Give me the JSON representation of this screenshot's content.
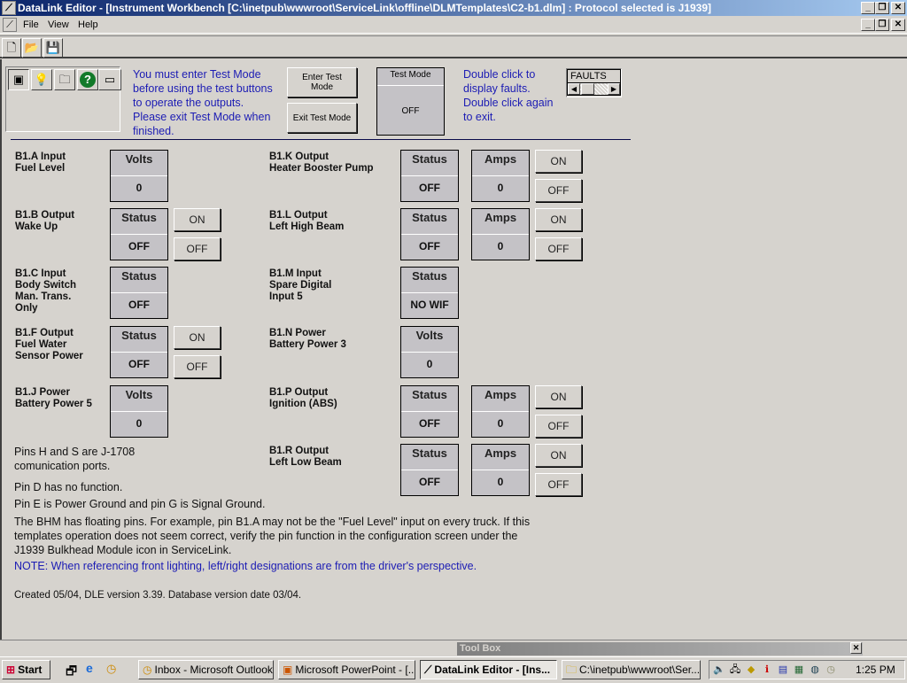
{
  "window": {
    "title": "DataLink Editor - [Instrument Workbench [C:\\inetpub\\wwwroot\\ServiceLink\\offline\\DLMTemplates\\C2-b1.dlm] : Protocol selected is J1939]",
    "minimize": "_",
    "restore": "❐",
    "close": "✕"
  },
  "menu": {
    "items": [
      {
        "label": "File"
      },
      {
        "label": "View"
      },
      {
        "label": "Help"
      }
    ]
  },
  "toolbar": {
    "new": "🗋",
    "open": "📂",
    "save": "💾"
  },
  "icon_panel": {
    "module": "▣",
    "bulb": "💡",
    "folder": "🗀",
    "help": "?",
    "device": "▭"
  },
  "instructions": {
    "test_mode_text": [
      "You must enter Test Mode",
      "before using the test buttons",
      "to operate the outputs.",
      "Please exit Test Mode when",
      "finished."
    ],
    "enter_test_mode": "Enter Test Mode",
    "exit_test_mode": "Exit Test Mode",
    "test_mode_label": "Test Mode",
    "test_mode_value": "OFF",
    "faults_text": [
      "Double click to",
      "display faults.",
      "Double click again",
      "to exit."
    ],
    "faults_label": "FAULTS"
  },
  "signals_left": [
    {
      "label": [
        "B1.A Input",
        "Fuel Level"
      ],
      "gauges": [
        {
          "head": "Volts",
          "value": "0"
        }
      ],
      "buttons": []
    },
    {
      "label": [
        "B1.B Output",
        "Wake Up"
      ],
      "gauges": [
        {
          "head": "Status",
          "value": "OFF"
        }
      ],
      "buttons": [
        "ON",
        "OFF"
      ]
    },
    {
      "label": [
        "B1.C Input",
        "Body Switch",
        "Man. Trans.",
        "Only"
      ],
      "gauges": [
        {
          "head": "Status",
          "value": "OFF"
        }
      ],
      "buttons": []
    },
    {
      "label": [
        "B1.F Output",
        "Fuel Water",
        "Sensor Power"
      ],
      "gauges": [
        {
          "head": "Status",
          "value": "OFF"
        }
      ],
      "buttons": [
        "ON",
        "OFF"
      ]
    },
    {
      "label": [
        "B1.J Power",
        "Battery Power 5"
      ],
      "gauges": [
        {
          "head": "Volts",
          "value": "0"
        }
      ],
      "buttons": []
    }
  ],
  "signals_right": [
    {
      "label": [
        "B1.K Output",
        "Heater Booster Pump"
      ],
      "gauges": [
        {
          "head": "Status",
          "value": "OFF"
        },
        {
          "head": "Amps",
          "value": "0"
        }
      ],
      "buttons": [
        "ON",
        "OFF"
      ]
    },
    {
      "label": [
        "B1.L Output",
        "Left High Beam"
      ],
      "gauges": [
        {
          "head": "Status",
          "value": "OFF"
        },
        {
          "head": "Amps",
          "value": "0"
        }
      ],
      "buttons": [
        "ON",
        "OFF"
      ]
    },
    {
      "label": [
        "B1.M Input",
        "Spare Digital",
        "Input 5"
      ],
      "gauges": [
        {
          "head": "Status",
          "value": "NO WIF"
        }
      ],
      "buttons": []
    },
    {
      "label": [
        "B1.N Power",
        "Battery Power 3"
      ],
      "gauges": [
        {
          "head": "Volts",
          "value": "0"
        }
      ],
      "buttons": []
    },
    {
      "label": [
        "B1.P Output",
        "Ignition (ABS)"
      ],
      "gauges": [
        {
          "head": "Status",
          "value": "OFF"
        },
        {
          "head": "Amps",
          "value": "0"
        }
      ],
      "buttons": [
        "ON",
        "OFF"
      ]
    },
    {
      "label": [
        "B1.R Output",
        "Left Low Beam"
      ],
      "gauges": [
        {
          "head": "Status",
          "value": "OFF"
        },
        {
          "head": "Amps",
          "value": "0"
        }
      ],
      "buttons": [
        "ON",
        "OFF"
      ]
    }
  ],
  "notes": {
    "pins_hs": [
      "Pins H and S are J-1708",
      "comunication ports."
    ],
    "pin_d": "Pin D has no function.",
    "pin_eg": "Pin E is Power Ground and pin G is Signal Ground.",
    "bhm": [
      "The BHM has floating pins.  For example, pin B1.A may not be the \"Fuel Level\" input on every truck.  If this",
      "templates operation does not seem correct, verify the pin function in the configuration screen under the",
      "J1939 Bulkhead Module icon in ServiceLink."
    ],
    "lighting_note": "NOTE:  When referencing front lighting, left/right designations are from the driver's perspective.",
    "created": "Created 05/04, DLE version 3.39.  Database version date 03/04."
  },
  "toolbox": {
    "title": "Tool Box",
    "close": "✕"
  },
  "taskbar": {
    "start": "Start",
    "tasks": [
      {
        "label": "Inbox - Microsoft Outlook"
      },
      {
        "label": "Microsoft PowerPoint - [..."
      },
      {
        "label": "DataLink Editor - [Ins..."
      },
      {
        "label": "C:\\inetpub\\wwwroot\\Ser..."
      }
    ],
    "clock": "1:25 PM"
  },
  "colors": {
    "title_start": "#0a246a",
    "title_end": "#a6caf0",
    "face": "#d6d3ce",
    "info_blue": "#1c1cb4"
  }
}
